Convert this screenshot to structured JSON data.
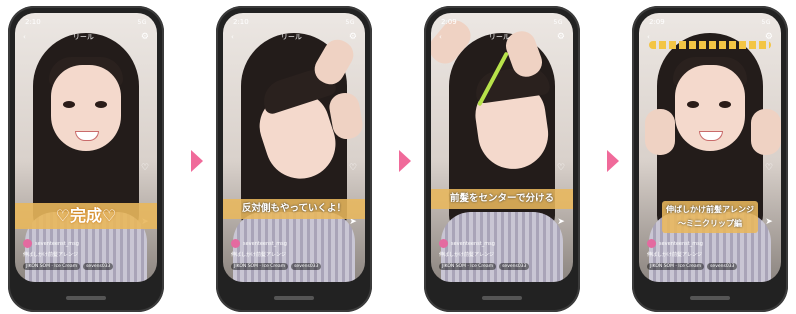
{
  "status_time": [
    "2:10",
    "2:10",
    "2:09",
    "2:09"
  ],
  "status_right": "5G",
  "reel_label": "リール",
  "captions": [
    "♡完成♡",
    "反対側もやっていくよ！",
    "前髪をセンターで分ける",
    "伸ばしかけ前髪アレンジ\n〜ミニクリップ編"
  ],
  "username": "seventeenst_msg",
  "description": "伸ばしかけ前髪アレンジ",
  "tags": [
    "JIKON SOM · Ice Cream",
    "sevens033"
  ],
  "icons": {
    "heart": "♡",
    "share": "➤",
    "gear": "⚙",
    "back": "‹"
  },
  "colors": {
    "arrow": "#f06a9a",
    "caption_bg": "#e8b75c"
  }
}
